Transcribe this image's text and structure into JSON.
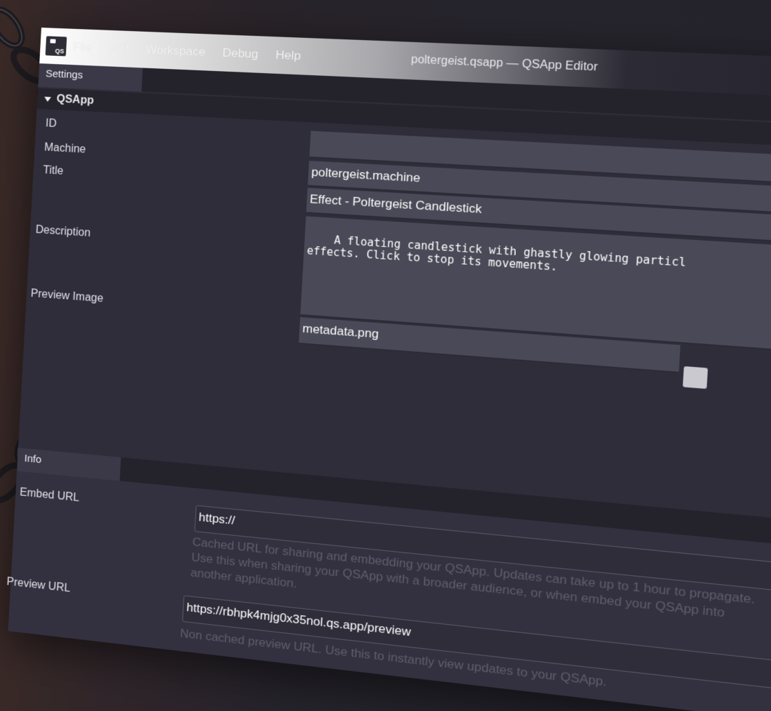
{
  "app": {
    "logo_text": "QS",
    "window_title": "poltergeist.qsapp — QSApp Editor"
  },
  "menu": {
    "items": [
      "File",
      "Edit",
      "Workspace",
      "Debug",
      "Help"
    ]
  },
  "settings": {
    "tab_label": "Settings",
    "group_label": "QSApp",
    "fields": {
      "id": {
        "label": "ID",
        "value": ""
      },
      "machine": {
        "label": "Machine",
        "value": "poltergeist.machine"
      },
      "title": {
        "label": "Title",
        "value": "Effect - Poltergeist Candlestick"
      },
      "description": {
        "label": "Description",
        "value": "A floating candlestick with ghastly glowing particl\neffects. Click to stop its movements."
      },
      "preview_image": {
        "label": "Preview Image",
        "value": "metadata.png"
      }
    }
  },
  "info": {
    "tab_label": "Info",
    "embed_url": {
      "label": "Embed URL",
      "value": "https://",
      "hint": "Cached URL for sharing and embedding your QSApp. Updates can take up to 1 hour to propagate. Use this when sharing your QSApp with a broader audience, or when embed your QSApp into another application."
    },
    "preview_url": {
      "label": "Preview URL",
      "value": "https://rbhpk4mjg0x35nol.qs.app/preview",
      "hint": "Non cached preview URL. Use this to instantly view updates to your QSApp."
    }
  },
  "colors": {
    "window_bg": "#2f2d3a",
    "field_bg": "#4a4957",
    "hint_text": "#5f5e6c"
  }
}
